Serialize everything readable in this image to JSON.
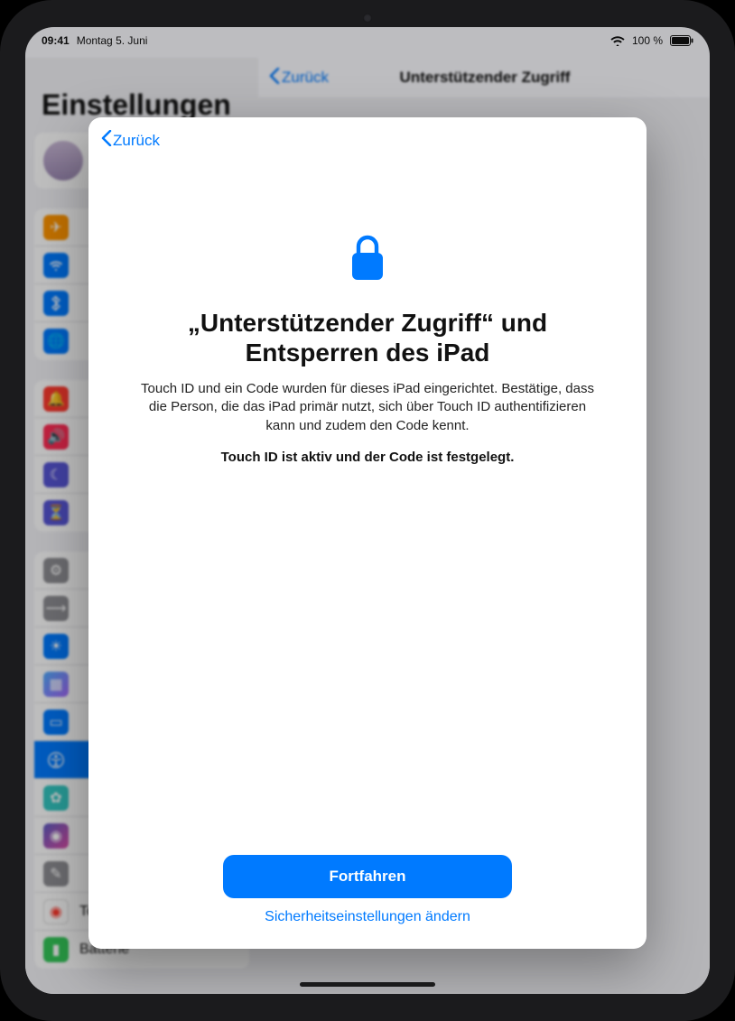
{
  "statusbar": {
    "time": "09:41",
    "date": "Montag 5. Juni",
    "battery_pct": "100 %"
  },
  "background": {
    "nav_back": "Zurück",
    "nav_title": "Unterstützender Zugriff",
    "sidebar_title": "Einstellungen",
    "rows_group3": {
      "touchid": "Touch ID & Code",
      "battery": "Batterie"
    }
  },
  "sheet": {
    "back": "Zurück",
    "title": "„Unterstützender Zugriff“ und Entsperren des iPad",
    "description": "Touch ID und ein Code wurden für dieses iPad eingerichtet. Bestätige, dass die Person, die das iPad primär nutzt, sich über Touch ID authentifizieren kann und zudem den Code kennt.",
    "status": "Touch ID ist aktiv und der Code ist festgelegt.",
    "continue": "Fortfahren",
    "change_security": "Sicherheitseinstellungen ändern"
  },
  "colors": {
    "accent": "#007aff"
  }
}
